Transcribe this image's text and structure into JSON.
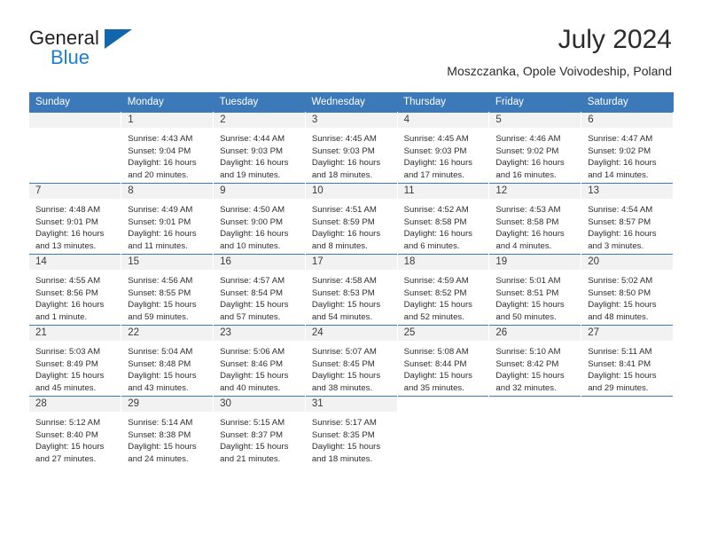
{
  "logo": {
    "word1": "General",
    "word2": "Blue",
    "triangle_color": "#1266ad",
    "blue_color": "#1c7fd4"
  },
  "header": {
    "title": "July 2024",
    "subtitle": "Moszczanka, Opole Voivodeship, Poland"
  },
  "theme": {
    "header_row_bg": "#3b79b8",
    "day_number_bg": "#f2f2f2",
    "text_color": "#2e2e2e"
  },
  "weekday_headers": [
    "Sunday",
    "Monday",
    "Tuesday",
    "Wednesday",
    "Thursday",
    "Friday",
    "Saturday"
  ],
  "labels": {
    "sunrise_prefix": "Sunrise:",
    "sunset_prefix": "Sunset:",
    "daylight_prefix": "Daylight:"
  },
  "weeks": [
    [
      {
        "day": "",
        "empty": true
      },
      {
        "day": "1",
        "sunrise": "Sunrise: 4:43 AM",
        "sunset": "Sunset: 9:04 PM",
        "daylight1": "Daylight: 16 hours",
        "daylight2": "and 20 minutes."
      },
      {
        "day": "2",
        "sunrise": "Sunrise: 4:44 AM",
        "sunset": "Sunset: 9:03 PM",
        "daylight1": "Daylight: 16 hours",
        "daylight2": "and 19 minutes."
      },
      {
        "day": "3",
        "sunrise": "Sunrise: 4:45 AM",
        "sunset": "Sunset: 9:03 PM",
        "daylight1": "Daylight: 16 hours",
        "daylight2": "and 18 minutes."
      },
      {
        "day": "4",
        "sunrise": "Sunrise: 4:45 AM",
        "sunset": "Sunset: 9:03 PM",
        "daylight1": "Daylight: 16 hours",
        "daylight2": "and 17 minutes."
      },
      {
        "day": "5",
        "sunrise": "Sunrise: 4:46 AM",
        "sunset": "Sunset: 9:02 PM",
        "daylight1": "Daylight: 16 hours",
        "daylight2": "and 16 minutes."
      },
      {
        "day": "6",
        "sunrise": "Sunrise: 4:47 AM",
        "sunset": "Sunset: 9:02 PM",
        "daylight1": "Daylight: 16 hours",
        "daylight2": "and 14 minutes."
      }
    ],
    [
      {
        "day": "7",
        "sunrise": "Sunrise: 4:48 AM",
        "sunset": "Sunset: 9:01 PM",
        "daylight1": "Daylight: 16 hours",
        "daylight2": "and 13 minutes."
      },
      {
        "day": "8",
        "sunrise": "Sunrise: 4:49 AM",
        "sunset": "Sunset: 9:01 PM",
        "daylight1": "Daylight: 16 hours",
        "daylight2": "and 11 minutes."
      },
      {
        "day": "9",
        "sunrise": "Sunrise: 4:50 AM",
        "sunset": "Sunset: 9:00 PM",
        "daylight1": "Daylight: 16 hours",
        "daylight2": "and 10 minutes."
      },
      {
        "day": "10",
        "sunrise": "Sunrise: 4:51 AM",
        "sunset": "Sunset: 8:59 PM",
        "daylight1": "Daylight: 16 hours",
        "daylight2": "and 8 minutes."
      },
      {
        "day": "11",
        "sunrise": "Sunrise: 4:52 AM",
        "sunset": "Sunset: 8:58 PM",
        "daylight1": "Daylight: 16 hours",
        "daylight2": "and 6 minutes."
      },
      {
        "day": "12",
        "sunrise": "Sunrise: 4:53 AM",
        "sunset": "Sunset: 8:58 PM",
        "daylight1": "Daylight: 16 hours",
        "daylight2": "and 4 minutes."
      },
      {
        "day": "13",
        "sunrise": "Sunrise: 4:54 AM",
        "sunset": "Sunset: 8:57 PM",
        "daylight1": "Daylight: 16 hours",
        "daylight2": "and 3 minutes."
      }
    ],
    [
      {
        "day": "14",
        "sunrise": "Sunrise: 4:55 AM",
        "sunset": "Sunset: 8:56 PM",
        "daylight1": "Daylight: 16 hours",
        "daylight2": "and 1 minute."
      },
      {
        "day": "15",
        "sunrise": "Sunrise: 4:56 AM",
        "sunset": "Sunset: 8:55 PM",
        "daylight1": "Daylight: 15 hours",
        "daylight2": "and 59 minutes."
      },
      {
        "day": "16",
        "sunrise": "Sunrise: 4:57 AM",
        "sunset": "Sunset: 8:54 PM",
        "daylight1": "Daylight: 15 hours",
        "daylight2": "and 57 minutes."
      },
      {
        "day": "17",
        "sunrise": "Sunrise: 4:58 AM",
        "sunset": "Sunset: 8:53 PM",
        "daylight1": "Daylight: 15 hours",
        "daylight2": "and 54 minutes."
      },
      {
        "day": "18",
        "sunrise": "Sunrise: 4:59 AM",
        "sunset": "Sunset: 8:52 PM",
        "daylight1": "Daylight: 15 hours",
        "daylight2": "and 52 minutes."
      },
      {
        "day": "19",
        "sunrise": "Sunrise: 5:01 AM",
        "sunset": "Sunset: 8:51 PM",
        "daylight1": "Daylight: 15 hours",
        "daylight2": "and 50 minutes."
      },
      {
        "day": "20",
        "sunrise": "Sunrise: 5:02 AM",
        "sunset": "Sunset: 8:50 PM",
        "daylight1": "Daylight: 15 hours",
        "daylight2": "and 48 minutes."
      }
    ],
    [
      {
        "day": "21",
        "sunrise": "Sunrise: 5:03 AM",
        "sunset": "Sunset: 8:49 PM",
        "daylight1": "Daylight: 15 hours",
        "daylight2": "and 45 minutes."
      },
      {
        "day": "22",
        "sunrise": "Sunrise: 5:04 AM",
        "sunset": "Sunset: 8:48 PM",
        "daylight1": "Daylight: 15 hours",
        "daylight2": "and 43 minutes."
      },
      {
        "day": "23",
        "sunrise": "Sunrise: 5:06 AM",
        "sunset": "Sunset: 8:46 PM",
        "daylight1": "Daylight: 15 hours",
        "daylight2": "and 40 minutes."
      },
      {
        "day": "24",
        "sunrise": "Sunrise: 5:07 AM",
        "sunset": "Sunset: 8:45 PM",
        "daylight1": "Daylight: 15 hours",
        "daylight2": "and 38 minutes."
      },
      {
        "day": "25",
        "sunrise": "Sunrise: 5:08 AM",
        "sunset": "Sunset: 8:44 PM",
        "daylight1": "Daylight: 15 hours",
        "daylight2": "and 35 minutes."
      },
      {
        "day": "26",
        "sunrise": "Sunrise: 5:10 AM",
        "sunset": "Sunset: 8:42 PM",
        "daylight1": "Daylight: 15 hours",
        "daylight2": "and 32 minutes."
      },
      {
        "day": "27",
        "sunrise": "Sunrise: 5:11 AM",
        "sunset": "Sunset: 8:41 PM",
        "daylight1": "Daylight: 15 hours",
        "daylight2": "and 29 minutes."
      }
    ],
    [
      {
        "day": "28",
        "sunrise": "Sunrise: 5:12 AM",
        "sunset": "Sunset: 8:40 PM",
        "daylight1": "Daylight: 15 hours",
        "daylight2": "and 27 minutes."
      },
      {
        "day": "29",
        "sunrise": "Sunrise: 5:14 AM",
        "sunset": "Sunset: 8:38 PM",
        "daylight1": "Daylight: 15 hours",
        "daylight2": "and 24 minutes."
      },
      {
        "day": "30",
        "sunrise": "Sunrise: 5:15 AM",
        "sunset": "Sunset: 8:37 PM",
        "daylight1": "Daylight: 15 hours",
        "daylight2": "and 21 minutes."
      },
      {
        "day": "31",
        "sunrise": "Sunrise: 5:17 AM",
        "sunset": "Sunset: 8:35 PM",
        "daylight1": "Daylight: 15 hours",
        "daylight2": "and 18 minutes."
      },
      {
        "day": "",
        "empty": true
      },
      {
        "day": "",
        "empty": true
      },
      {
        "day": "",
        "empty": true
      }
    ]
  ]
}
